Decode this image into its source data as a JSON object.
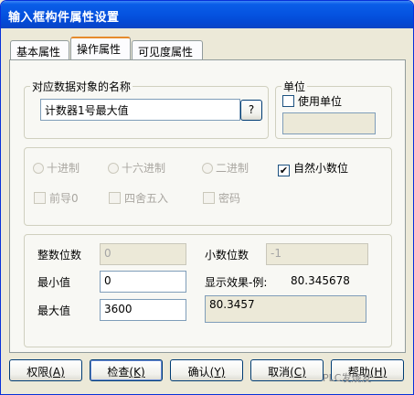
{
  "window": {
    "title": "输入框构件属性设置"
  },
  "tabs": [
    {
      "label": "基本属性",
      "active": false
    },
    {
      "label": "操作属性",
      "active": true
    },
    {
      "label": "可见度属性",
      "active": false
    }
  ],
  "data_object": {
    "legend": "对应数据对象的名称",
    "value": "计数器1号最大值",
    "browse_label": "?"
  },
  "unit": {
    "legend": "单位",
    "use_unit_label": "使用单位",
    "use_unit_checked": false,
    "unit_value": ""
  },
  "format": {
    "radios": [
      "十进制",
      "十六进制",
      "二进制"
    ],
    "natural_decimal_label": "自然小数位",
    "natural_decimal_checked": true,
    "leading_zero_label": "前导0",
    "rounding_label": "四舍五入",
    "password_label": "密码"
  },
  "numbers": {
    "integer_digits_label": "整数位数",
    "integer_digits_value": "0",
    "decimal_digits_label": "小数位数",
    "decimal_digits_value": "-1",
    "min_label": "最小值",
    "min_value": "0",
    "max_label": "最大值",
    "max_value": "3600",
    "preview_label": "显示效果-例:",
    "preview_example": "80.345678",
    "preview_result": "80.3457"
  },
  "buttons": [
    {
      "label": "权限",
      "hotkey": "(A)"
    },
    {
      "label": "检查",
      "hotkey": "(K)"
    },
    {
      "label": "确认",
      "hotkey": "(Y)"
    },
    {
      "label": "取消",
      "hotkey": "(C)"
    },
    {
      "label": "帮助",
      "hotkey": "(H)"
    }
  ],
  "watermark": "PLC发烧友",
  "colors": {
    "titlebar": "#0553e0",
    "active_tab_accent": "#e68b2c",
    "dialog_bg": "#ece9d8"
  }
}
